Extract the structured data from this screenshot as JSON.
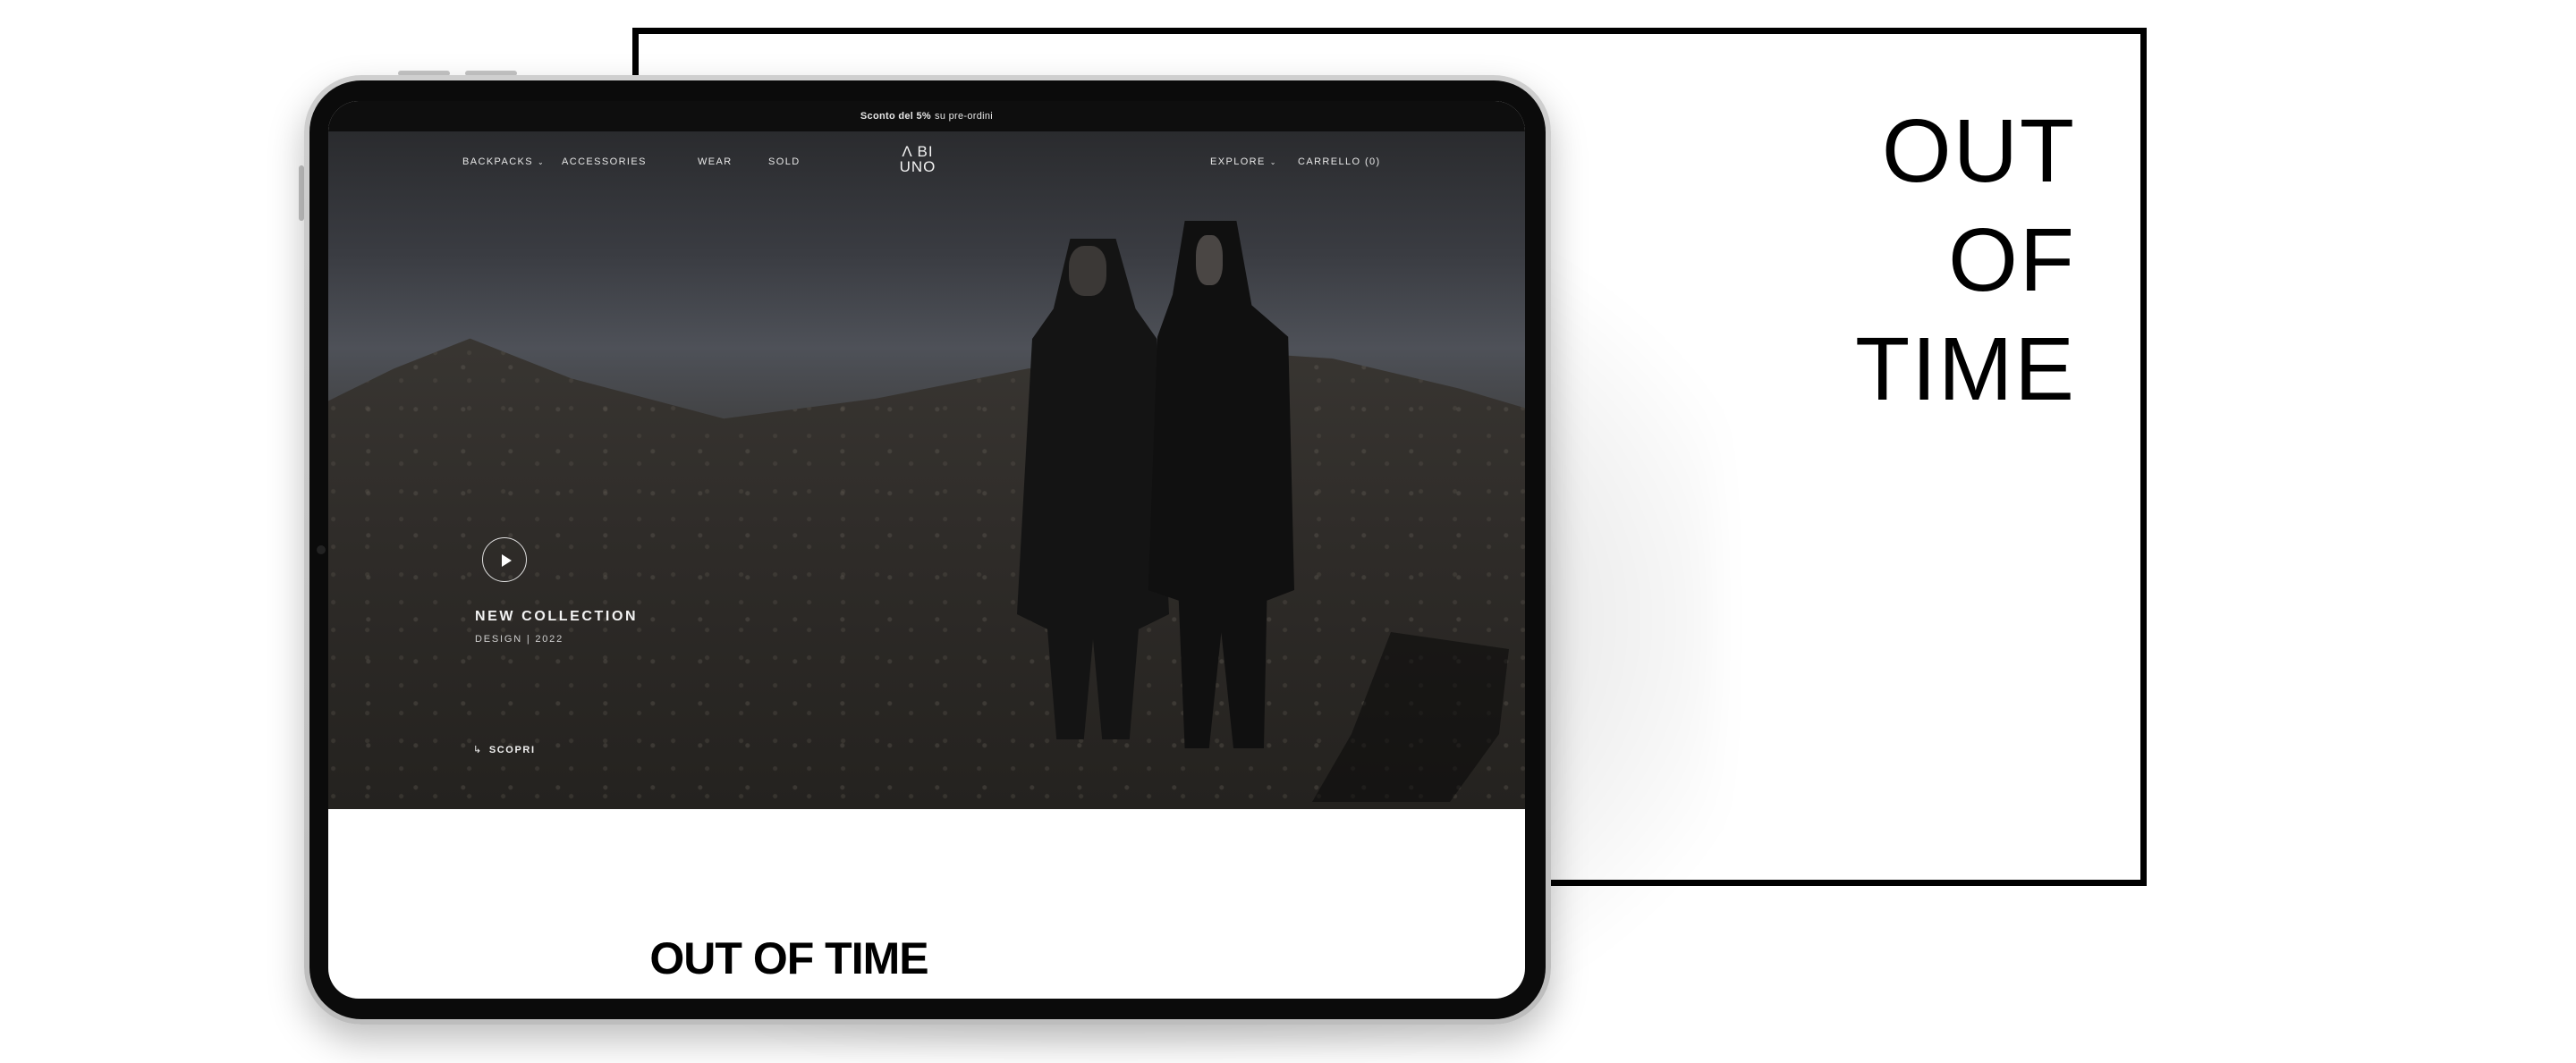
{
  "poster": {
    "title_lines": [
      "OUT",
      "OF",
      "TIME"
    ]
  },
  "announcement": {
    "bold": "Sconto del 5%",
    "rest": "su pre-ordini"
  },
  "nav": {
    "backpacks": "BACKPACKS",
    "accessories": "ACCESSORIES",
    "wear": "WEAR",
    "sold": "SOLD",
    "explore": "EXPLORE",
    "cart": "CARRELLO (0)",
    "chevron": "⌄"
  },
  "logo": {
    "line1": "Λ BI",
    "line2": "UNO"
  },
  "hero": {
    "title": "NEW COLLECTION",
    "subtitle": "DESIGN | 2022",
    "cta": "SCOPRI",
    "cta_arrow": "↳"
  },
  "section": {
    "title": "OUT OF TIME"
  },
  "colors": {
    "frame": "#000000",
    "announcement_bg": "#0e0e0e",
    "hero_text": "#f3f3f3"
  },
  "icons": [
    "play-icon",
    "chevron-down-icon",
    "return-arrow-icon"
  ]
}
